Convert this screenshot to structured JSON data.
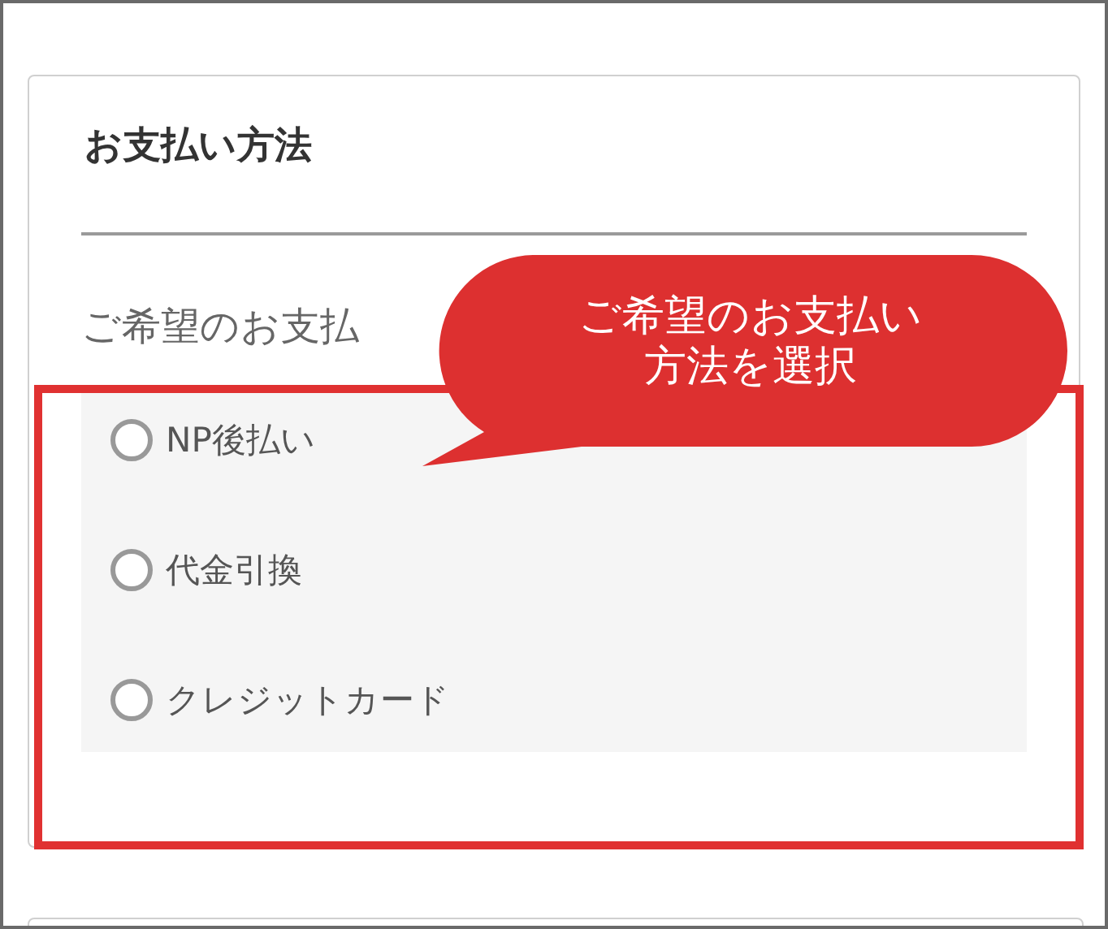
{
  "section": {
    "title": "お支払い方法",
    "hint": "ご希望のお支払"
  },
  "payment_options": [
    {
      "label": "NP後払い",
      "selected": false
    },
    {
      "label": "代金引換",
      "selected": false
    },
    {
      "label": "クレジットカード",
      "selected": false
    }
  ],
  "callout": {
    "lines": [
      "ご希望のお支払い",
      "方法を選択"
    ]
  }
}
